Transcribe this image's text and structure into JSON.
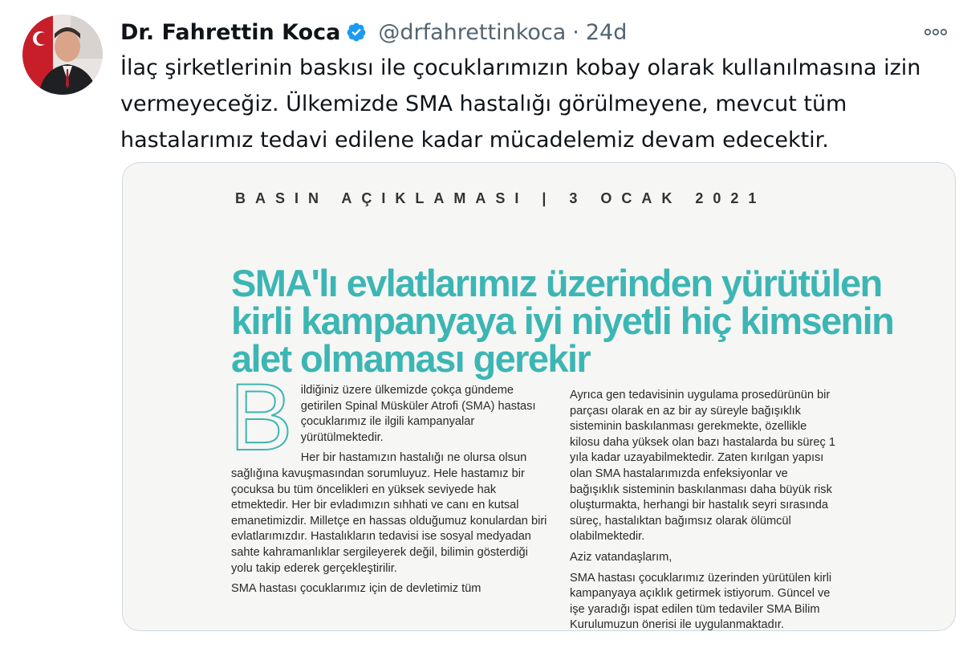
{
  "tweet": {
    "author": {
      "display_name": "Dr. Fahrettin Koca",
      "verified": true,
      "handle": "@drfahrettinkoca",
      "avatar_icon": "profile-photo"
    },
    "separator": "·",
    "time": "24d",
    "more_icon": "more-horizontal-icon",
    "text_lines": [
      "İlaç şirketlerinin baskısı ile çocuklarımızın kobay olarak kullanılmasına izin",
      "vermeyeceğiz. Ülkemizde SMA hastalığı görülmeyene, mevcut tüm",
      "hastalarımız tedavi edilene kadar mücadelemiz devam edecektir."
    ]
  },
  "media": {
    "press_header": "BASIN AÇIKLAMASI | 3 OCAK 2021",
    "headline_lines": [
      "SMA'lı evlatlarımız üzerinden yürütülen",
      "kirli kampanyaya iyi niyetli hiç kimsenin",
      "alet olmaması gerekir"
    ],
    "drop_cap": "B",
    "left_column": {
      "first_paragraph": "ildiğiniz üzere ülkemizde çokça gündeme getirilen Spinal Müsküler Atrofi (SMA) hastası çocuklarımız ile ilgili kampanyalar yürütülmektedir.",
      "paragraphs": [
        "Her bir hastamızın hastalığı ne olursa olsun sağlığına kavuşmasından sorumluyuz. Hele hastamız bir çocuksa bu tüm öncelikleri en yüksek seviyede hak etmektedir. Her bir evladımızın sıhhati ve canı en kutsal emanetimizdir. Milletçe en hassas olduğumuz konulardan biri evlatlarımızdır. Hastalıkların tedavisi ise sosyal medyadan sahte kahramanlıklar sergileyerek değil, bilimin gösterdiği yolu takip ederek gerçekleştirilir.",
        "SMA hastası çocuklarımız için de devletimiz tüm"
      ]
    },
    "right_column": {
      "paragraphs": [
        "Ayrıca gen tedavisinin uygulama prosedürünün bir parçası olarak en az bir ay süreyle bağışıklık sisteminin baskılanması gerekmekte, özellikle kilosu daha yüksek olan bazı hastalarda bu süreç 1 yıla kadar uzayabilmektedir. Zaten kırılgan yapısı olan SMA hastalarımızda enfeksiyonlar ve bağışıklık sisteminin baskılanması daha büyük risk oluşturmakta, herhangi bir hastalık seyri sırasında süreç, hastalıktan bağımsız olarak ölümcül olabilmektedir.",
        "Aziz vatandaşlarım,",
        "SMA hastası çocuklarımız üzerinden yürütülen kirli kampanyaya açıklık getirmek istiyorum. Güncel ve işe yaradığı ispat edilen tüm tedaviler SMA Bilim Kurulumuzun önerisi ile uygulanmaktadır."
      ]
    }
  },
  "colors": {
    "text": "#0f1419",
    "secondary": "#536471",
    "verified_blue": "#1d9bf0",
    "headline_teal": "#3cb6b4",
    "card_border": "#cfd9de"
  }
}
